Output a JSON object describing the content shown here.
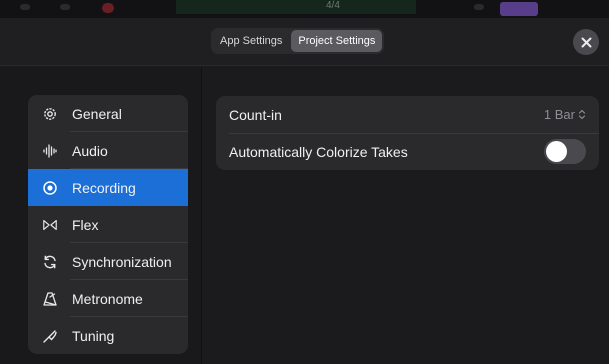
{
  "header": {
    "tabs": [
      {
        "label": "App Settings",
        "active": false
      },
      {
        "label": "Project Settings",
        "active": true
      }
    ],
    "close_icon": "close-icon"
  },
  "sidebar": {
    "items": [
      {
        "label": "General",
        "icon": "gear-icon",
        "selected": false
      },
      {
        "label": "Audio",
        "icon": "waveform-icon",
        "selected": false
      },
      {
        "label": "Recording",
        "icon": "record-icon",
        "selected": true
      },
      {
        "label": "Flex",
        "icon": "flex-icon",
        "selected": false
      },
      {
        "label": "Synchronization",
        "icon": "sync-icon",
        "selected": false
      },
      {
        "label": "Metronome",
        "icon": "metronome-icon",
        "selected": false
      },
      {
        "label": "Tuning",
        "icon": "tuning-fork-icon",
        "selected": false
      }
    ]
  },
  "recording": {
    "count_in": {
      "label": "Count-in",
      "value": "1 Bar"
    },
    "colorize": {
      "label": "Automatically Colorize Takes",
      "on": false
    }
  },
  "background": {
    "ruler_text": "4/4"
  },
  "colors": {
    "accent": "#1d6fd8",
    "panel": "#2a2a2d",
    "background": "#1b1b1d"
  }
}
